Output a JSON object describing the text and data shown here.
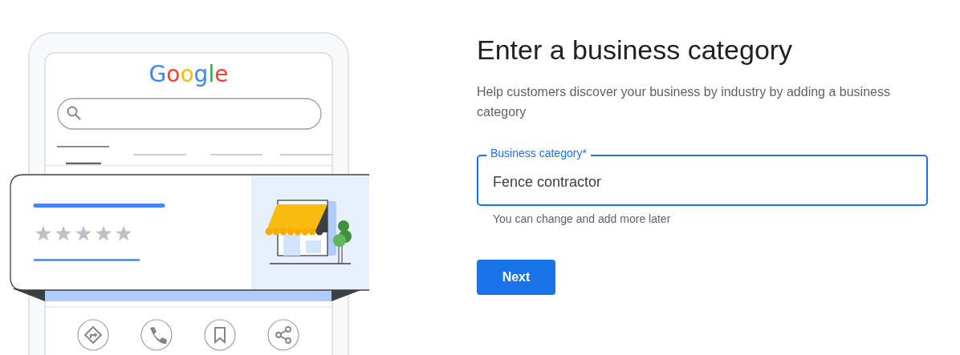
{
  "illustration": {
    "logo": "Google"
  },
  "form": {
    "title": "Enter a business category",
    "description": "Help customers discover your business by industry by adding a business category",
    "field": {
      "label": "Business category*",
      "value": "Fence contractor",
      "focused": true
    },
    "helper": "You can change and add more later",
    "button": "Next"
  }
}
